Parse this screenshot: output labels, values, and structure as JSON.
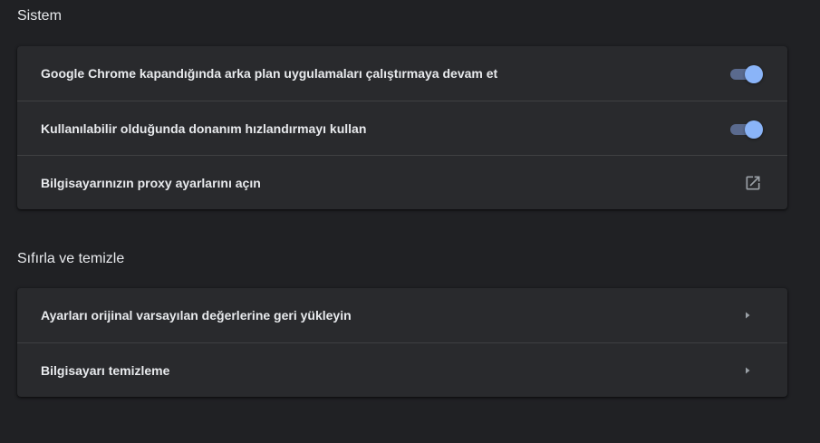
{
  "sections": [
    {
      "title": "Sistem",
      "items": [
        {
          "label": "Google Chrome kapandığında arka plan uygulamaları çalıştırmaya devam et",
          "control": "toggle",
          "checked": true
        },
        {
          "label": "Kullanılabilir olduğunda donanım hızlandırmayı kullan",
          "control": "toggle",
          "checked": true
        },
        {
          "label": "Bilgisayarınızın proxy ayarlarını açın",
          "control": "open-in-new-icon"
        }
      ]
    },
    {
      "title": "Sıfırla ve temizle",
      "items": [
        {
          "label": "Ayarları orijinal varsayılan değerlerine geri yükleyin",
          "control": "chevron-right-icon"
        },
        {
          "label": "Bilgisayarı temizleme",
          "control": "chevron-right-icon"
        }
      ]
    }
  ],
  "colors": {
    "background": "#202124",
    "card": "#292a2d",
    "accent": "#8ab4f8",
    "toggle_track": "#5a6a8e",
    "text": "#e8eaed",
    "icon": "#9aa0a6"
  }
}
